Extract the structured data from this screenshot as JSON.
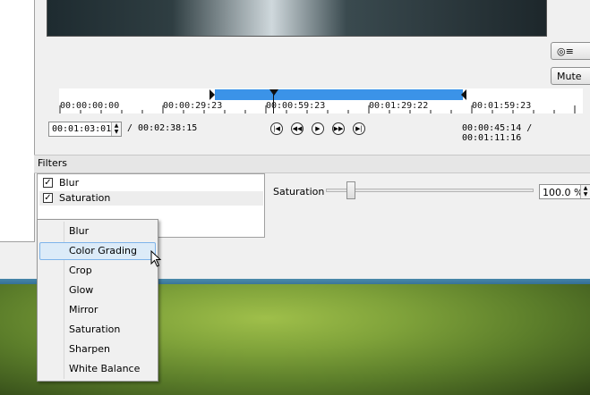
{
  "side_buttons": {
    "top_label": "◎≡",
    "mute_label": "Mute"
  },
  "timeline": {
    "labels": [
      "00:00:00:00",
      "00:00:29:23",
      "00:00:59:23",
      "00:01:29:22",
      "00:01:59:23"
    ],
    "colors": {
      "range": "#3b93e8"
    }
  },
  "transport": {
    "current_time": "00:01:03:01",
    "total_time": "/ 00:02:38:15",
    "in_out": "00:00:45:14 / 00:01:11:16",
    "buttons": [
      "skip-to-start",
      "rewind",
      "play",
      "fast-forward",
      "skip-to-end"
    ]
  },
  "filters": {
    "title": "Filters",
    "list": [
      {
        "label": "Blur",
        "checked": true
      },
      {
        "label": "Saturation",
        "checked": true
      }
    ],
    "saturation_label": "Saturation",
    "saturation_value": "100.0 %",
    "saturation_level": 0.12
  },
  "menu": {
    "items": [
      "Blur",
      "Color Grading",
      "Crop",
      "Glow",
      "Mirror",
      "Saturation",
      "Sharpen",
      "White Balance"
    ],
    "highlighted": "Color Grading"
  }
}
